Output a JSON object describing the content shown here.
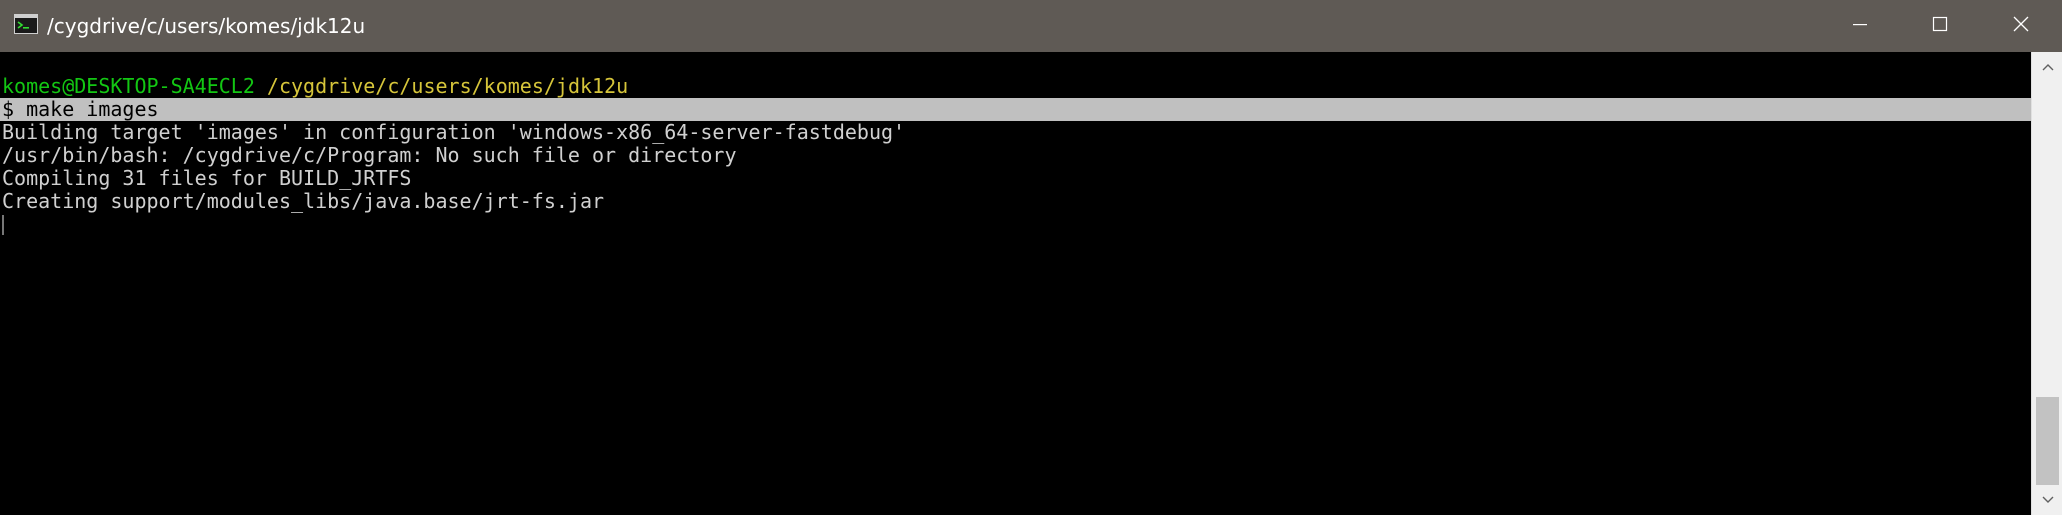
{
  "window": {
    "title": "/cygdrive/c/users/komes/jdk12u",
    "titlebar_color": "#5f5a55"
  },
  "icons": {
    "app": "terminal-icon",
    "minimize": "minimize-icon",
    "maximize": "maximize-icon",
    "close": "close-icon",
    "scroll_up": "chevron-up-icon",
    "scroll_down": "chevron-down-icon"
  },
  "terminal": {
    "prompt_user": "komes@DESKTOP-SA4ECL2",
    "prompt_path": "/cygdrive/c/users/komes/jdk12u",
    "command": "$ make images",
    "output": [
      "Building target 'images' in configuration 'windows-x86_64-server-fastdebug'",
      "/usr/bin/bash: /cygdrive/c/Program: No such file or directory",
      "Compiling 31 files for BUILD_JRTFS",
      "Creating support/modules_libs/java.base/jrt-fs.jar"
    ],
    "colors": {
      "user": "#13c713",
      "path": "#d6c53a",
      "text": "#d0d0d0",
      "highlight": "#c0c0c0"
    }
  }
}
